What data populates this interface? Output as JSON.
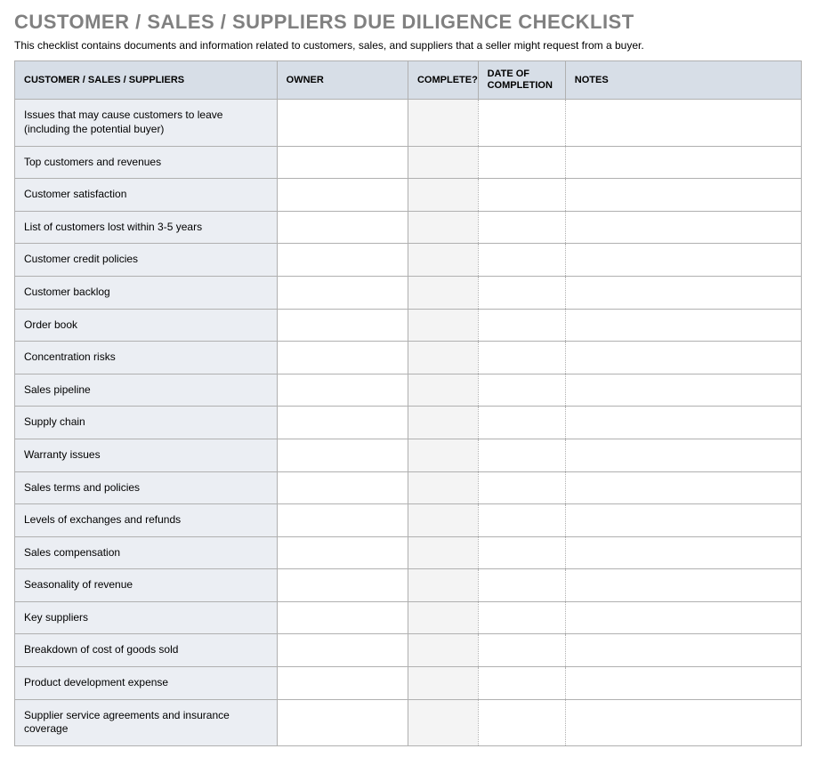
{
  "header": {
    "title": "CUSTOMER / SALES / SUPPLIERS DUE DILIGENCE CHECKLIST",
    "subtitle": "This checklist contains documents and information related to customers, sales, and suppliers that a seller might request from a buyer."
  },
  "table": {
    "columns": {
      "item": "CUSTOMER / SALES / SUPPLIERS",
      "owner": "OWNER",
      "complete": "COMPLETE?",
      "date": "DATE OF COMPLETION",
      "notes": "NOTES"
    },
    "rows": [
      {
        "item": "Issues that may cause customers to leave (including the potential buyer)",
        "owner": "",
        "complete": "",
        "date": "",
        "notes": ""
      },
      {
        "item": "Top customers and revenues",
        "owner": "",
        "complete": "",
        "date": "",
        "notes": ""
      },
      {
        "item": "Customer satisfaction",
        "owner": "",
        "complete": "",
        "date": "",
        "notes": ""
      },
      {
        "item": "List of customers lost within 3-5 years",
        "owner": "",
        "complete": "",
        "date": "",
        "notes": ""
      },
      {
        "item": "Customer credit policies",
        "owner": "",
        "complete": "",
        "date": "",
        "notes": ""
      },
      {
        "item": "Customer backlog",
        "owner": "",
        "complete": "",
        "date": "",
        "notes": ""
      },
      {
        "item": "Order book",
        "owner": "",
        "complete": "",
        "date": "",
        "notes": ""
      },
      {
        "item": "Concentration risks",
        "owner": "",
        "complete": "",
        "date": "",
        "notes": ""
      },
      {
        "item": "Sales pipeline",
        "owner": "",
        "complete": "",
        "date": "",
        "notes": ""
      },
      {
        "item": "Supply chain",
        "owner": "",
        "complete": "",
        "date": "",
        "notes": ""
      },
      {
        "item": "Warranty issues",
        "owner": "",
        "complete": "",
        "date": "",
        "notes": ""
      },
      {
        "item": "Sales terms and policies",
        "owner": "",
        "complete": "",
        "date": "",
        "notes": ""
      },
      {
        "item": "Levels of exchanges and refunds",
        "owner": "",
        "complete": "",
        "date": "",
        "notes": ""
      },
      {
        "item": "Sales compensation",
        "owner": "",
        "complete": "",
        "date": "",
        "notes": ""
      },
      {
        "item": "Seasonality of revenue",
        "owner": "",
        "complete": "",
        "date": "",
        "notes": ""
      },
      {
        "item": "Key suppliers",
        "owner": "",
        "complete": "",
        "date": "",
        "notes": ""
      },
      {
        "item": "Breakdown of cost of goods sold",
        "owner": "",
        "complete": "",
        "date": "",
        "notes": ""
      },
      {
        "item": "Product development expense",
        "owner": "",
        "complete": "",
        "date": "",
        "notes": ""
      },
      {
        "item": "Supplier service agreements and insurance coverage",
        "owner": "",
        "complete": "",
        "date": "",
        "notes": ""
      }
    ]
  }
}
